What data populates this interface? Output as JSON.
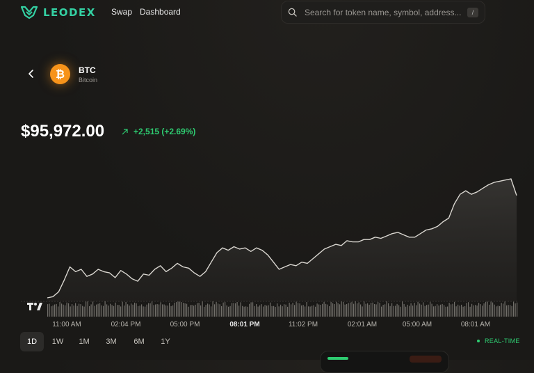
{
  "brand": {
    "name": "LEODEX",
    "accent": "#34d1a3"
  },
  "nav": {
    "swap": "Swap",
    "dashboard": "Dashboard"
  },
  "search": {
    "placeholder": "Search for token name, symbol, address...",
    "shortcut": "/",
    "icon": "search-icon"
  },
  "token": {
    "symbol": "BTC",
    "name": "Bitcoin",
    "icon": "bitcoin-icon",
    "color": "#f7931a"
  },
  "price": {
    "value": "$95,972.00",
    "change": "+2,515 (+2.69%)",
    "direction": "up",
    "change_color": "#2ecc71"
  },
  "chart_data": {
    "type": "area",
    "x_ticks": [
      "11:00 AM",
      "02:04 PM",
      "05:00 PM",
      "08:01 PM",
      "11:02 PM",
      "02:01 AM",
      "05:00 AM",
      "08:01 AM"
    ],
    "highlighted_tick": "08:01 PM",
    "grid": false,
    "line_color": "#d9d6d0",
    "shape_note": "relative price shape, 0 = start of day range, 1 = high",
    "values": [
      0.0,
      0.01,
      0.05,
      0.15,
      0.26,
      0.22,
      0.24,
      0.18,
      0.2,
      0.24,
      0.22,
      0.21,
      0.17,
      0.23,
      0.2,
      0.16,
      0.14,
      0.2,
      0.19,
      0.24,
      0.27,
      0.22,
      0.25,
      0.29,
      0.26,
      0.25,
      0.21,
      0.18,
      0.22,
      0.3,
      0.38,
      0.42,
      0.4,
      0.43,
      0.41,
      0.42,
      0.39,
      0.42,
      0.4,
      0.36,
      0.3,
      0.24,
      0.26,
      0.28,
      0.27,
      0.3,
      0.29,
      0.33,
      0.37,
      0.41,
      0.43,
      0.45,
      0.44,
      0.48,
      0.47,
      0.47,
      0.49,
      0.49,
      0.51,
      0.5,
      0.52,
      0.54,
      0.55,
      0.53,
      0.51,
      0.51,
      0.54,
      0.57,
      0.58,
      0.6,
      0.64,
      0.67,
      0.79,
      0.87,
      0.9,
      0.87,
      0.89,
      0.92,
      0.95,
      0.97,
      0.98,
      0.99,
      1.0,
      0.86
    ],
    "volume_bars": true
  },
  "ranges": [
    "1D",
    "1W",
    "1M",
    "3M",
    "6M",
    "1Y"
  ],
  "active_range": "1D",
  "realtime": "REAL-TIME"
}
